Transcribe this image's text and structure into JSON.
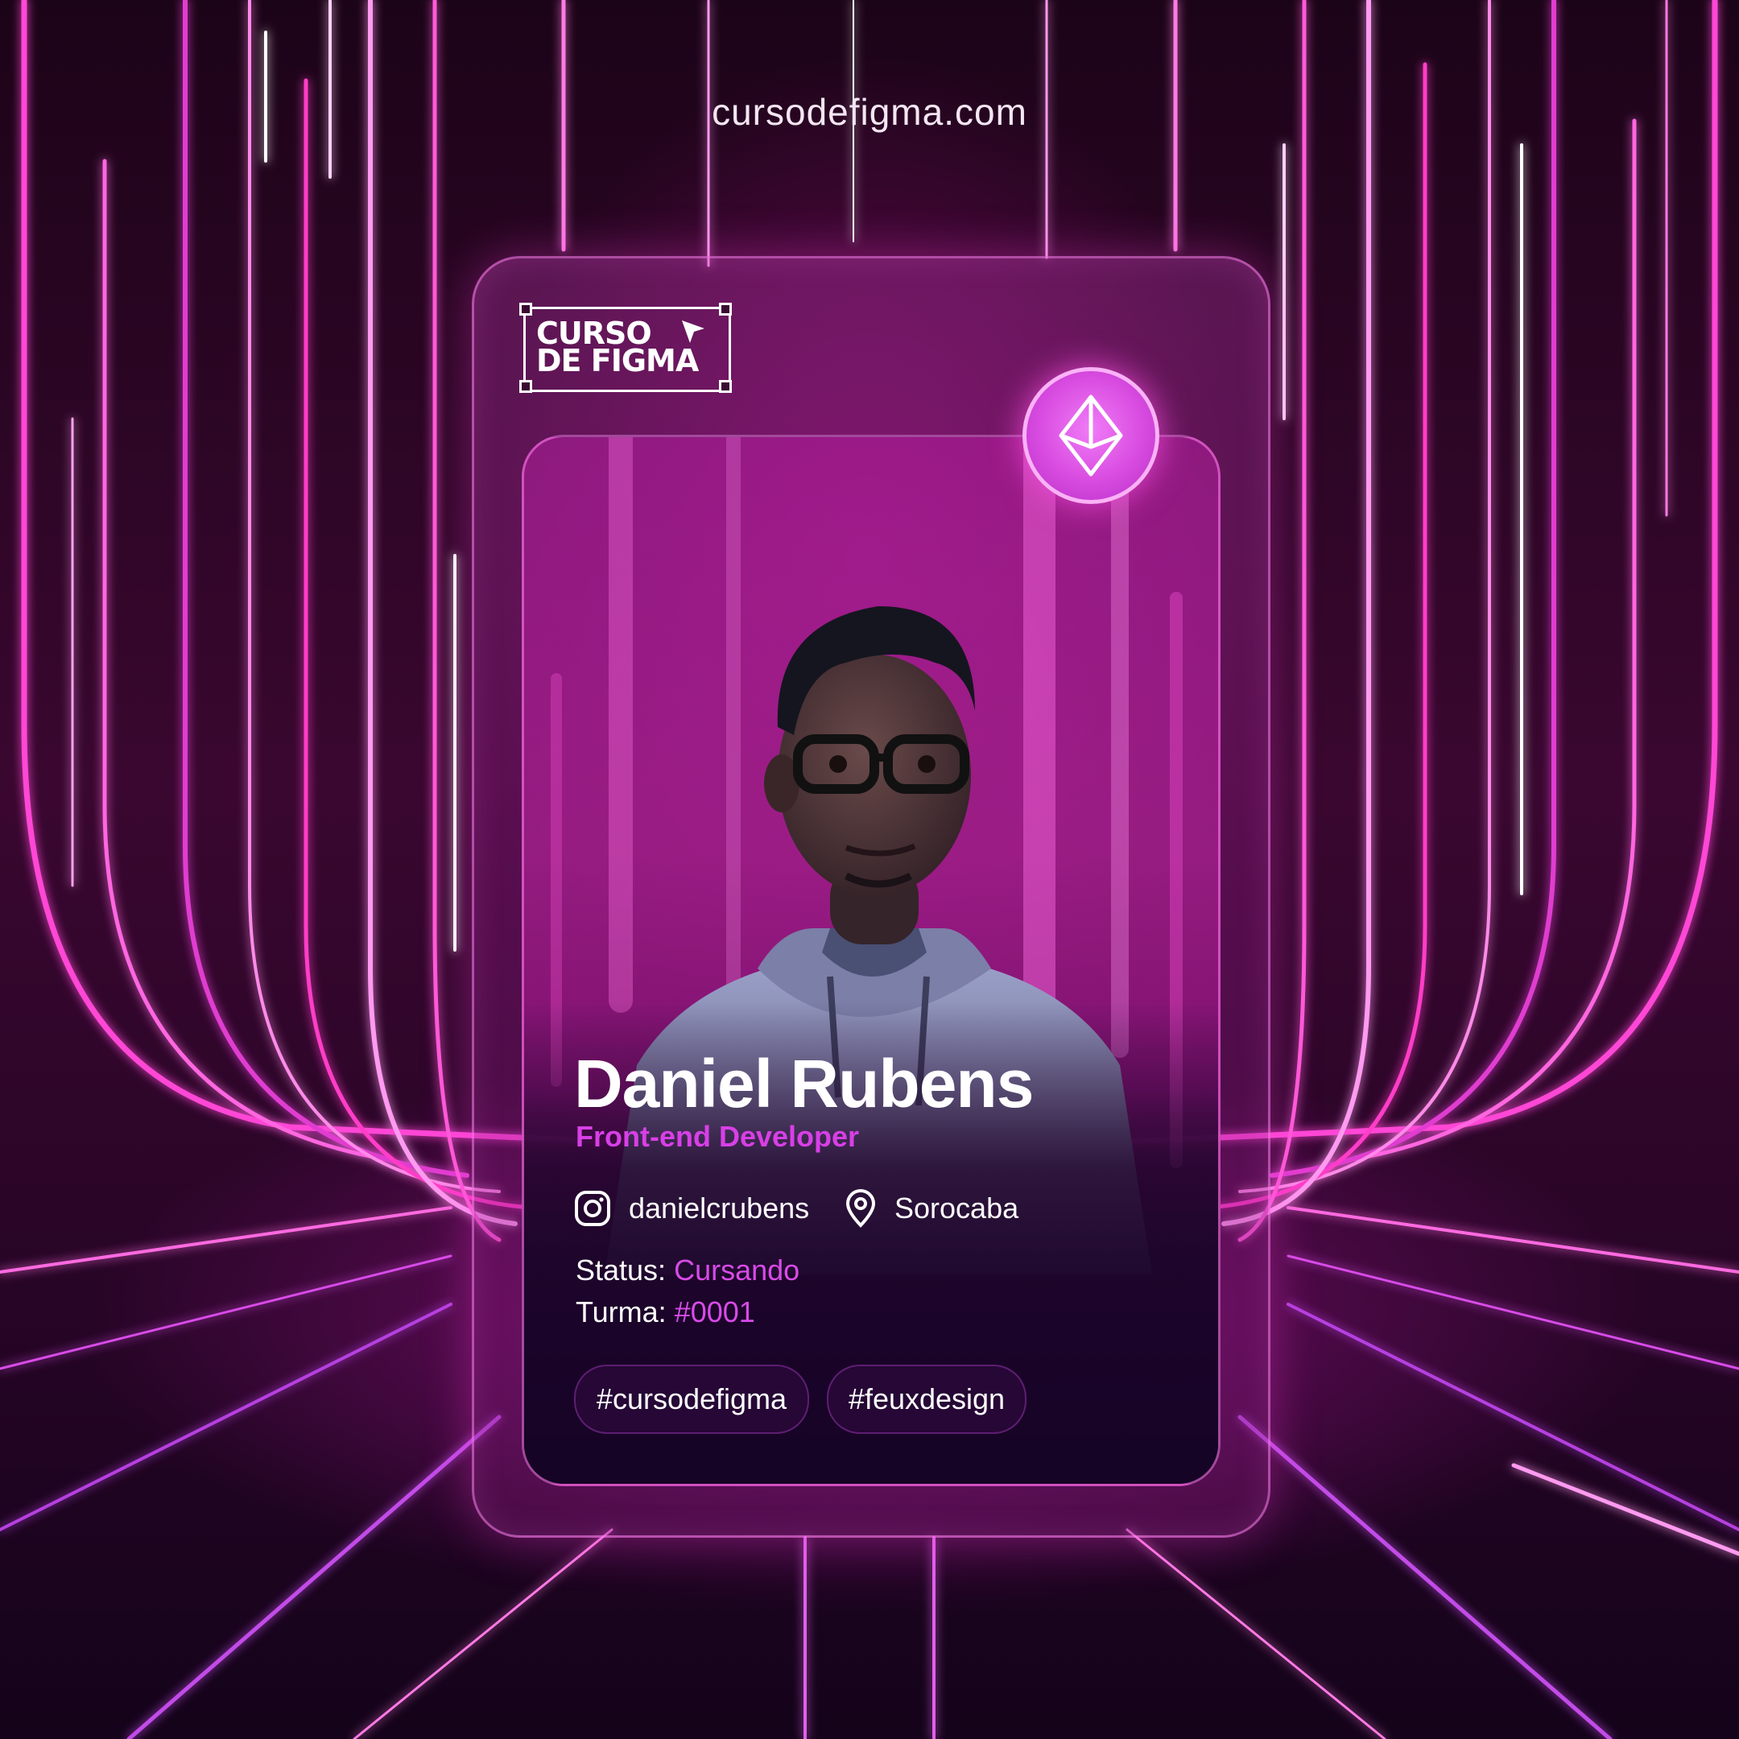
{
  "site": {
    "domain": "cursodefigma.com"
  },
  "logo": {
    "line1": "CURSO",
    "line2": "DE FIGMA",
    "icon": "cursor-arrow-icon"
  },
  "badge": {
    "icon": "ethereum-icon"
  },
  "profile": {
    "name": "Daniel Rubens",
    "role": "Front-end Developer",
    "instagram": {
      "icon": "instagram-icon",
      "handle": "danielcrubens"
    },
    "location": {
      "icon": "map-pin-icon",
      "city": "Sorocaba"
    },
    "status": {
      "label": "Status:",
      "value": "Cursando"
    },
    "turma": {
      "label": "Turma:",
      "value": "#0001"
    },
    "tags": [
      "#cursodefigma",
      "#feuxdesign"
    ]
  },
  "colors": {
    "accent": "#d83fe6",
    "neon": "#ff3fd0",
    "background": "#2a0528",
    "panel_dark": "#170427"
  }
}
